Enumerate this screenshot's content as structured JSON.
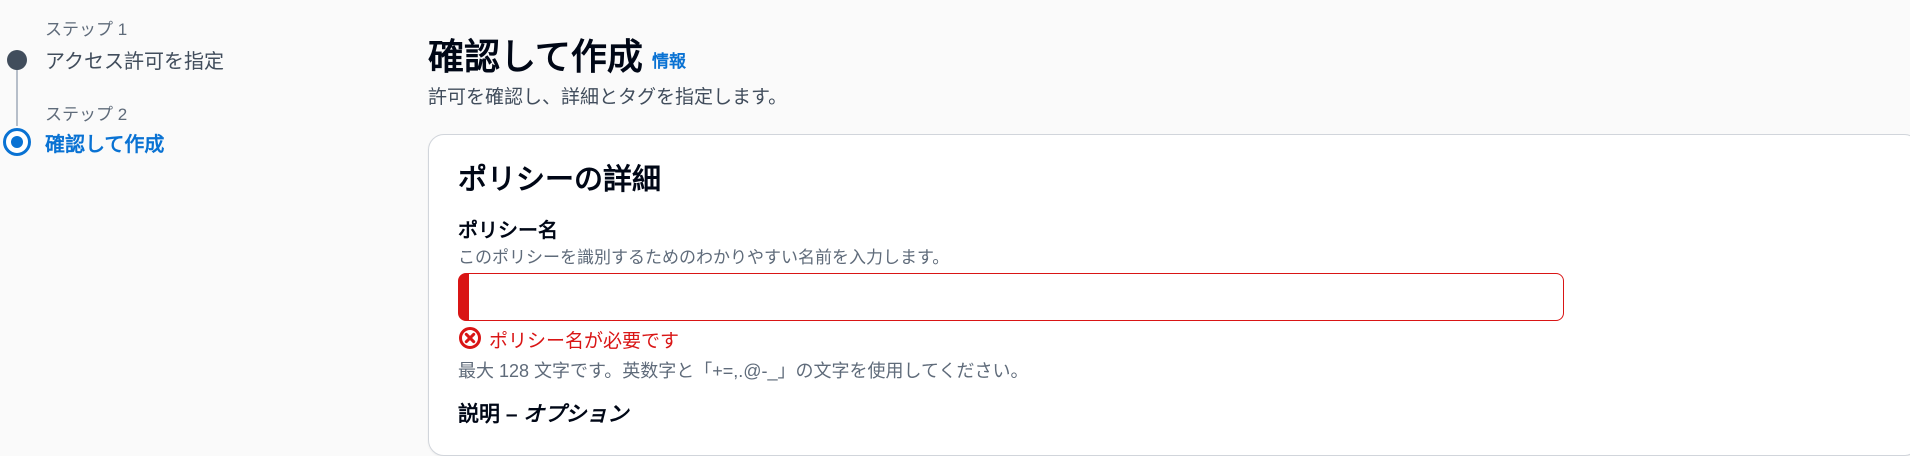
{
  "steps": [
    {
      "caption": "ステップ 1",
      "title": "アクセス許可を指定",
      "state": "completed"
    },
    {
      "caption": "ステップ 2",
      "title": "確認して作成",
      "state": "active"
    }
  ],
  "header": {
    "title": "確認して作成",
    "info_link": "情報",
    "description": "許可を確認し、詳細とタグを指定します。"
  },
  "policy_details": {
    "title": "ポリシーの詳細",
    "name_field": {
      "label": "ポリシー名",
      "description": "このポリシーを識別するためのわかりやすい名前を入力します。",
      "value": "",
      "error": "ポリシー名が必要です",
      "constraint": "最大 128 文字です。英数字と「+=,.@-_」の文字を使用してください。"
    },
    "description_field": {
      "label_main": "説明 – ",
      "label_optional": "オプション"
    }
  },
  "colors": {
    "accent": "#0972d3",
    "error": "#d91515",
    "completed_step": "#414d5c"
  },
  "icons": {
    "completed_step": "filled-circle-icon",
    "active_step": "radio-circle-icon",
    "error": "error-circle-x-icon"
  }
}
